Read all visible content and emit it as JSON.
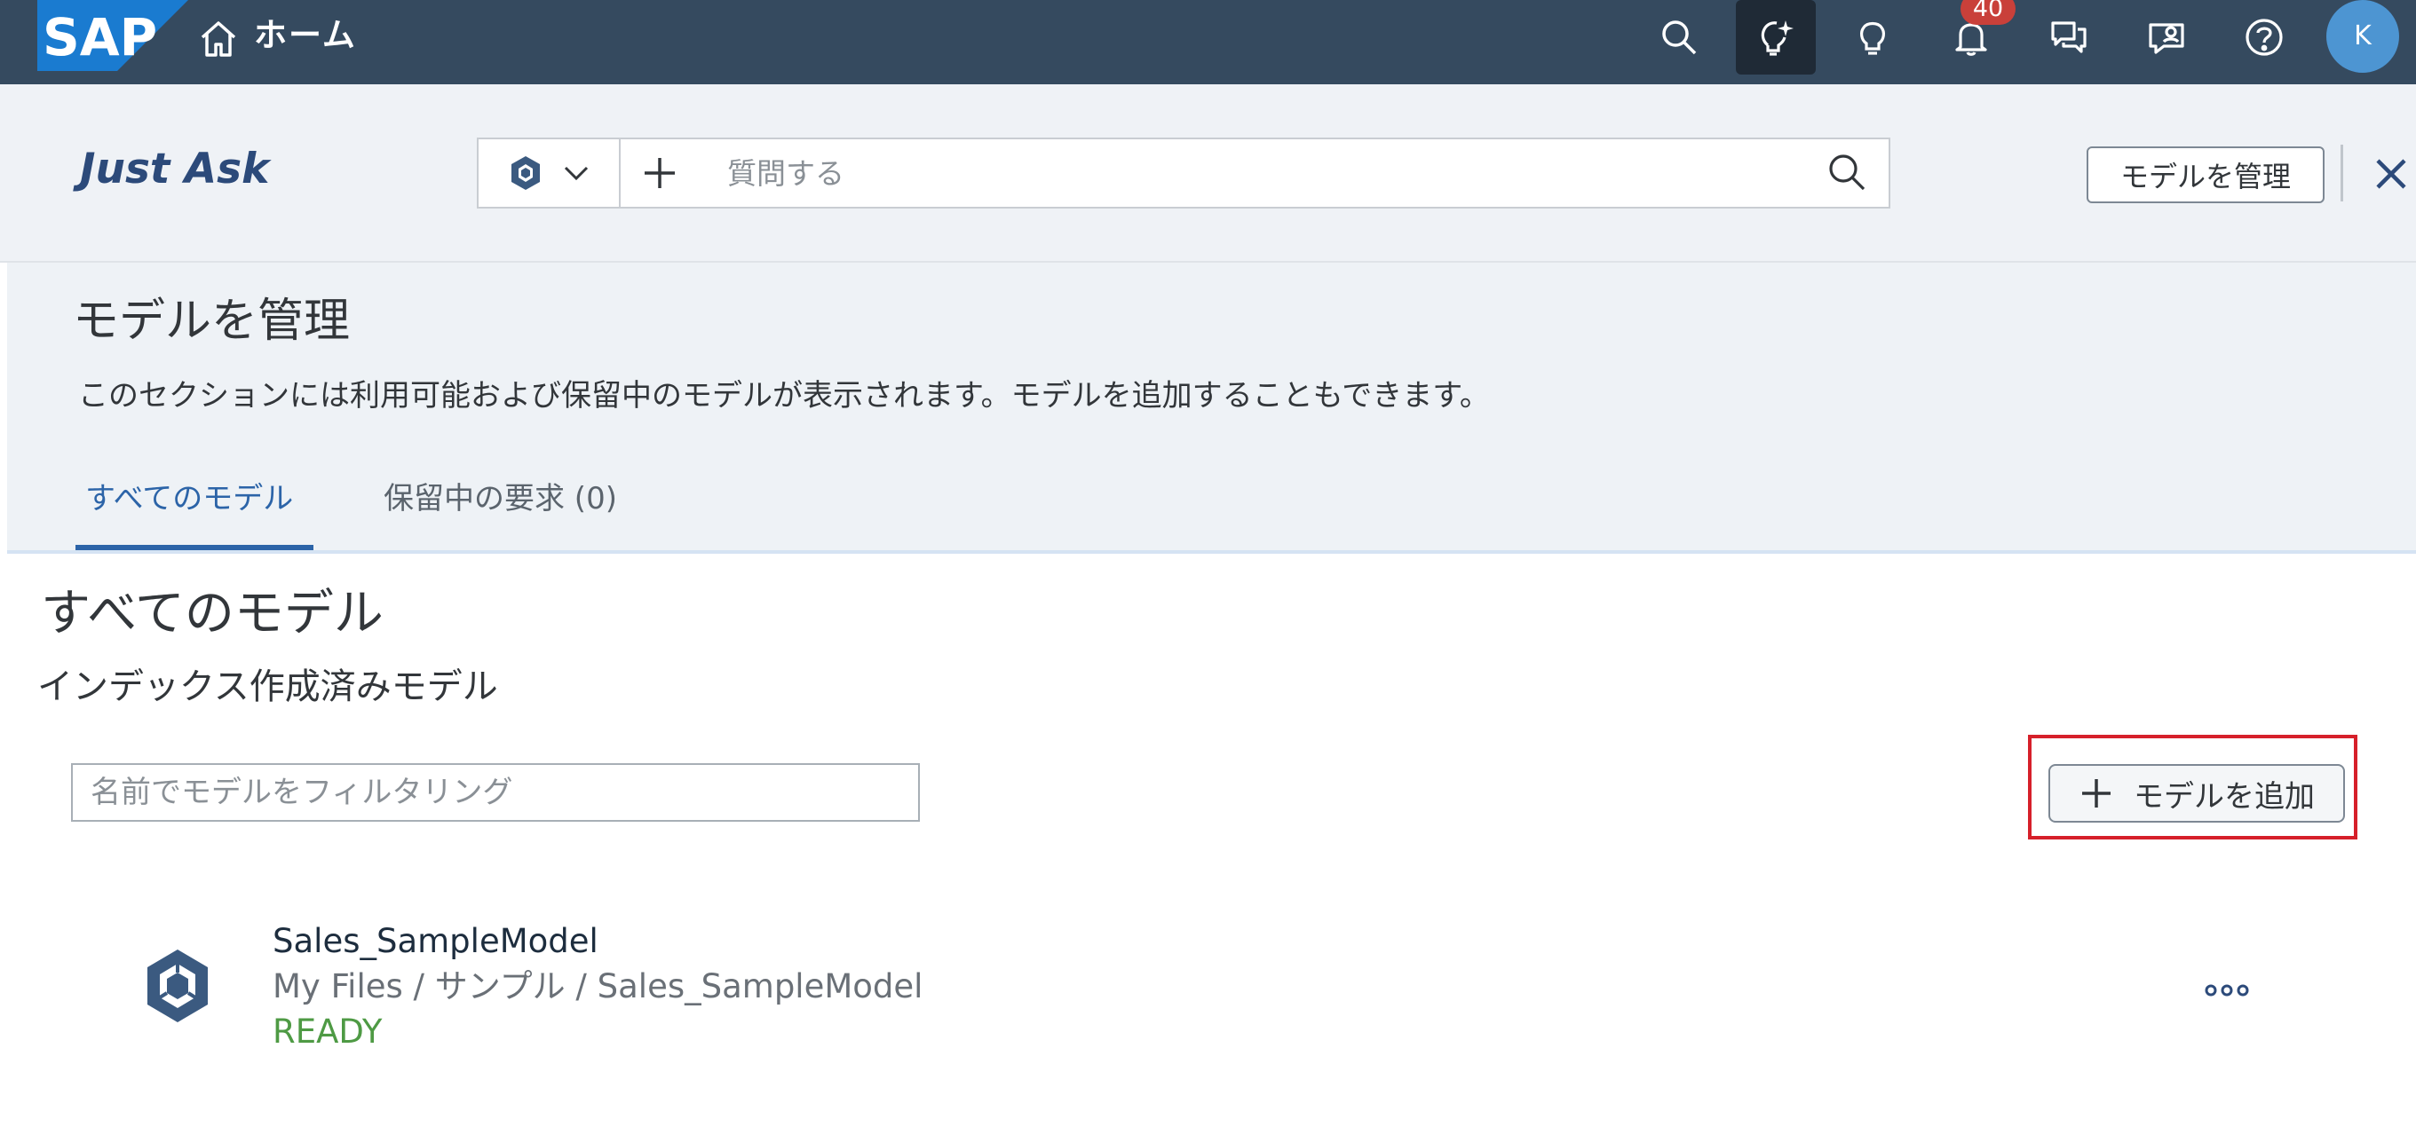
{
  "shell": {
    "logo_text": "SAP",
    "home_title": "ホーム",
    "notification_count": "40",
    "avatar_initial": "K",
    "colors": {
      "bar": "#354a5f",
      "badge": "#c9403a",
      "avatar": "#4d95d2"
    },
    "icons": [
      "search-icon",
      "just-ask-icon",
      "lightbulb-icon",
      "bell-icon",
      "chat-icon",
      "feedback-icon",
      "help-icon"
    ]
  },
  "askbar": {
    "title": "Just Ask",
    "placeholder": "質問する",
    "manage_label": "モデルを管理"
  },
  "manage": {
    "title": "モデルを管理",
    "description": "このセクションには利用可能および保留中のモデルが表示されます。モデルを追加することもできます。",
    "tabs": [
      {
        "label": "すべてのモデル",
        "selected": true
      },
      {
        "label": "保留中の要求 (0)",
        "selected": false
      }
    ]
  },
  "content": {
    "title": "すべてのモデル",
    "subtitle": "インデックス作成済みモデル",
    "filter_placeholder": "名前でモデルをフィルタリング",
    "add_label": "モデルを追加",
    "models": [
      {
        "name": "Sales_SampleModel",
        "path": "My Files / サンプル / Sales_SampleModel",
        "status": "READY"
      }
    ],
    "colors": {
      "accent": "#2c64a8",
      "status_ready": "#4e9a44",
      "highlight": "#d6202a"
    }
  }
}
